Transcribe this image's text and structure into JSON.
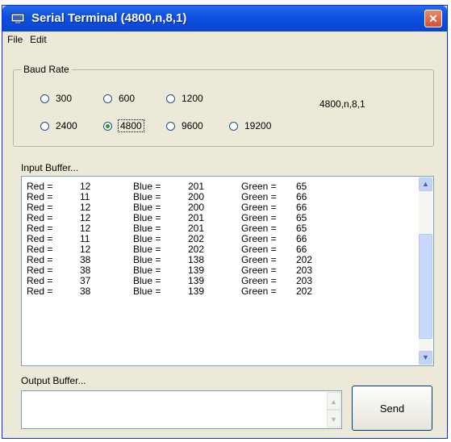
{
  "window": {
    "title": "Serial Terminal (4800,n,8,1)"
  },
  "menu": [
    "File",
    "Edit"
  ],
  "baud": {
    "label": "Baud Rate",
    "options": [
      "300",
      "600",
      "1200",
      "2400",
      "4800",
      "9600",
      "19200"
    ],
    "selected": "4800",
    "config": "4800,n,8,1"
  },
  "input": {
    "label": "Input Buffer...",
    "rows": [
      {
        "red_label": "Red =",
        "red": "12",
        "blue_label": "Blue =",
        "blue": "201",
        "green_label": "Green =",
        "green": "65"
      },
      {
        "red_label": "Red =",
        "red": "11",
        "blue_label": "Blue =",
        "blue": "200",
        "green_label": "Green =",
        "green": "66"
      },
      {
        "red_label": "Red =",
        "red": "12",
        "blue_label": "Blue =",
        "blue": "200",
        "green_label": "Green =",
        "green": "66"
      },
      {
        "red_label": "Red =",
        "red": "12",
        "blue_label": "Blue =",
        "blue": "201",
        "green_label": "Green =",
        "green": "65"
      },
      {
        "red_label": "Red =",
        "red": "12",
        "blue_label": "Blue =",
        "blue": "201",
        "green_label": "Green =",
        "green": "65"
      },
      {
        "red_label": "Red =",
        "red": "11",
        "blue_label": "Blue =",
        "blue": "202",
        "green_label": "Green =",
        "green": "66"
      },
      {
        "red_label": "Red =",
        "red": "12",
        "blue_label": "Blue =",
        "blue": "202",
        "green_label": "Green =",
        "green": "66"
      },
      {
        "red_label": "Red =",
        "red": "38",
        "blue_label": "Blue =",
        "blue": "138",
        "green_label": "Green =",
        "green": "202"
      },
      {
        "red_label": "Red =",
        "red": "38",
        "blue_label": "Blue =",
        "blue": "139",
        "green_label": "Green =",
        "green": "203"
      },
      {
        "red_label": "Red =",
        "red": "37",
        "blue_label": "Blue =",
        "blue": "139",
        "green_label": "Green =",
        "green": "203"
      },
      {
        "red_label": "Red =",
        "red": "38",
        "blue_label": "Blue =",
        "blue": "139",
        "green_label": "Green =",
        "green": "202"
      }
    ]
  },
  "output": {
    "label": "Output Buffer...",
    "value": ""
  },
  "send_label": "Send",
  "icons": {
    "app": "serial-terminal-icon",
    "close": "close-icon",
    "scroll_up": "scroll-up-arrow-icon",
    "scroll_down": "scroll-down-arrow-icon"
  },
  "colors": {
    "titlebar": "#0a45d2",
    "close": "#d4502e",
    "radio_dot": "#21a121",
    "scroll": "#c8d9fc"
  }
}
